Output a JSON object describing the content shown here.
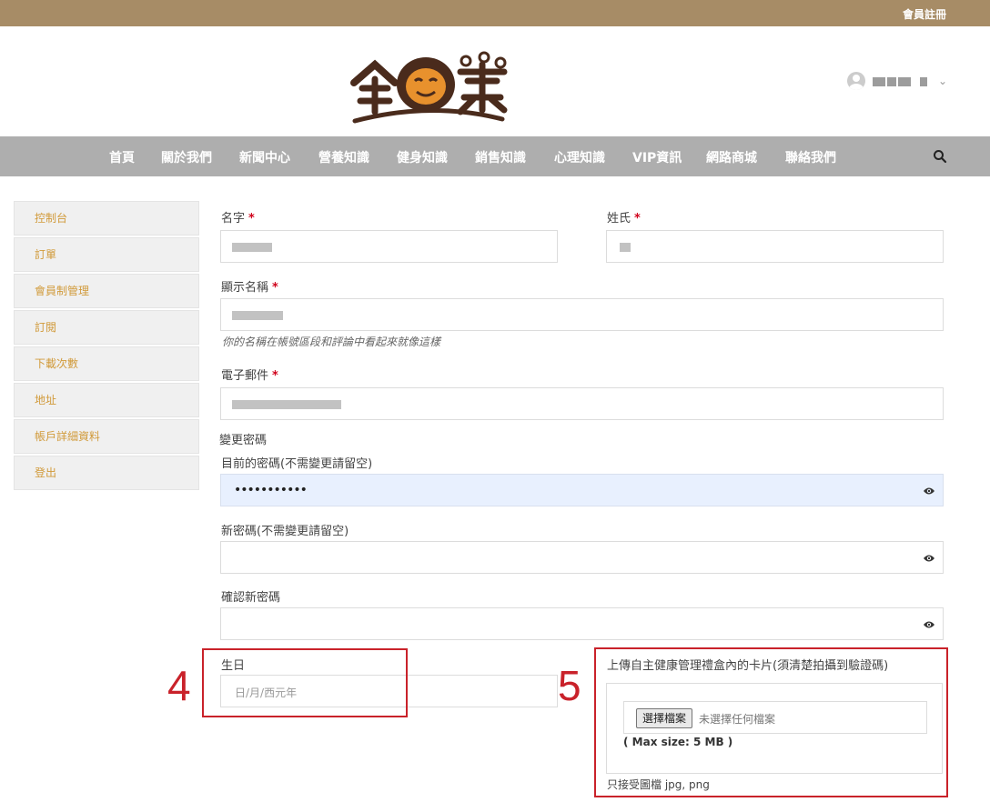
{
  "topbar": {
    "register_link": "會員註冊"
  },
  "header": {
    "logo_icon": "brand-logo",
    "user_menu_icon": "chevron-down-icon"
  },
  "nav": {
    "items": [
      "首頁",
      "關於我們",
      "新聞中心",
      "營養知識",
      "健身知識",
      "銷售知識",
      "心理知識",
      "VIP資訊",
      "網路商城",
      "聯絡我們"
    ],
    "search_icon": "search-icon"
  },
  "sidebar": {
    "items": [
      "控制台",
      "訂單",
      "會員制管理",
      "訂閱",
      "下載次數",
      "地址",
      "帳戶詳細資料",
      "登出"
    ]
  },
  "form": {
    "first_name_label": "名字",
    "last_name_label": "姓氏",
    "display_name_label": "顯示名稱",
    "display_name_hint": "你的名稱在帳號區段和評論中看起來就像這樣",
    "email_label": "電子郵件",
    "required_mark": "*",
    "change_password_heading": "變更密碼",
    "current_password_label": "目前的密碼(不需變更請留空)",
    "current_password_value": "•••••••••••",
    "new_password_label": "新密碼(不需變更請留空)",
    "confirm_password_label": "確認新密碼",
    "birthday_label": "生日",
    "birthday_placeholder": "日/月/西元年",
    "upload_label": "上傳自主健康管理禮盒內的卡片(須清楚拍攝到驗證碼)",
    "file_button": "選擇檔案",
    "file_none": "未選擇任何檔案",
    "max_size": "( Max size: 5 MB )",
    "accepted_types": "只接受圖檔 jpg, png"
  },
  "annotations": {
    "num4": "4",
    "num5": "5"
  },
  "colors": {
    "topbar": "#a78c66",
    "nav": "#aeaeae",
    "sidebar_text": "#d19a3a",
    "required": "#d0021b",
    "annotation": "#c9222a"
  }
}
